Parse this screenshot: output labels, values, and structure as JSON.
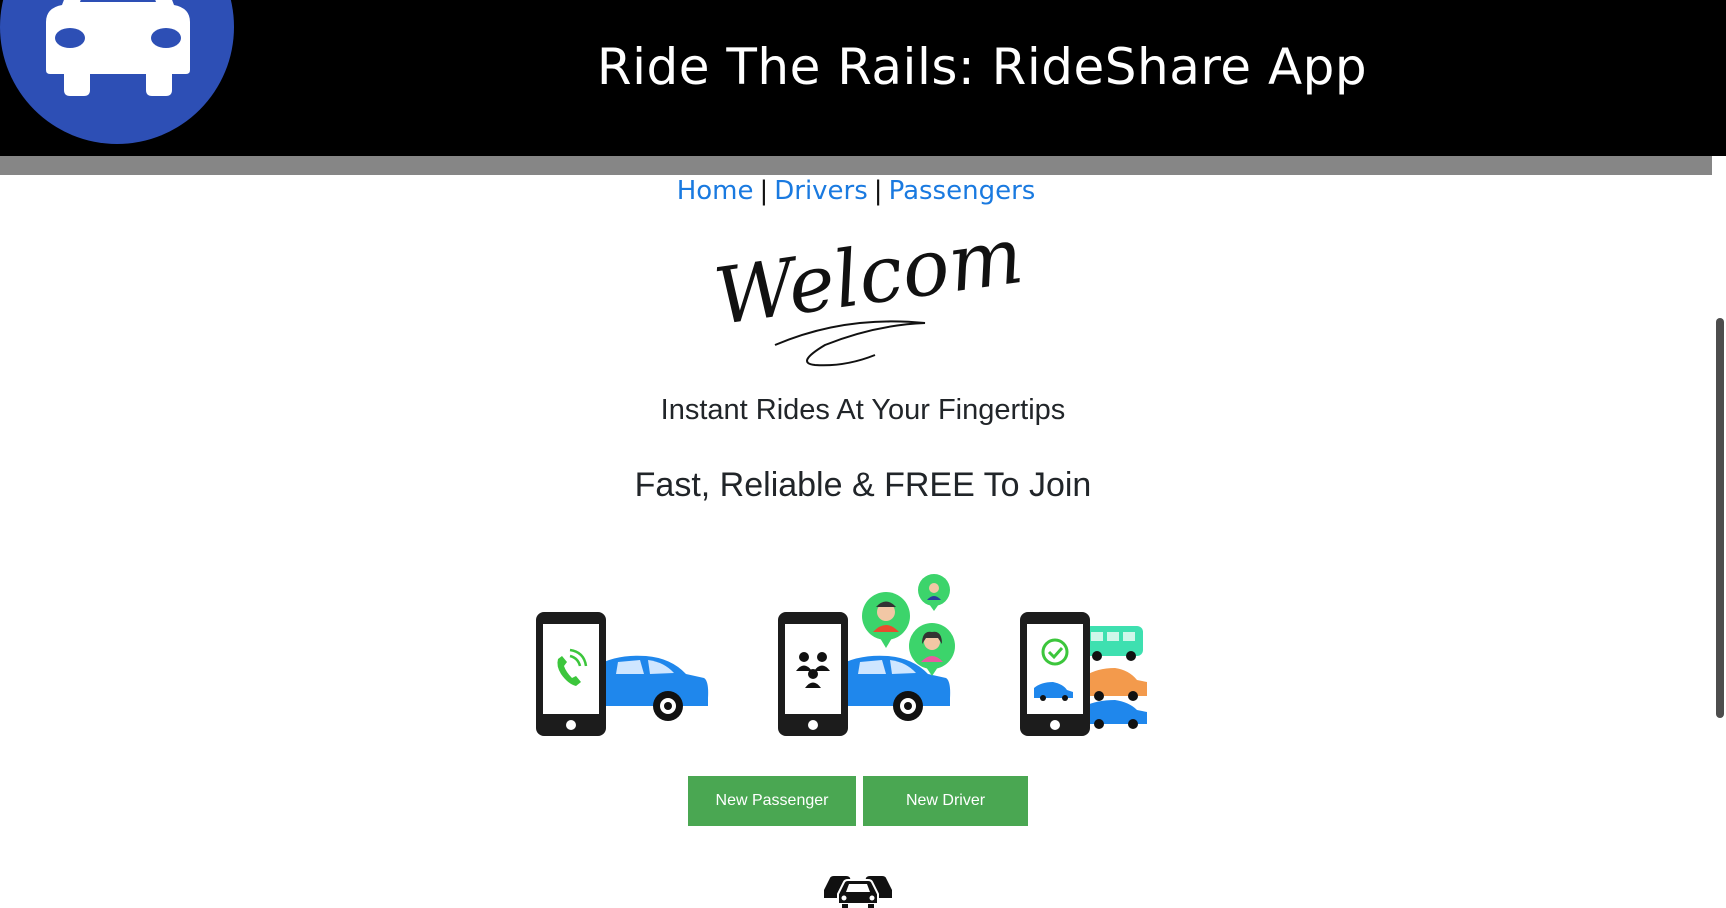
{
  "header": {
    "title": "Ride The Rails: RideShare App",
    "logo_icon": "car-icon",
    "logo_color": "#2d4fb5"
  },
  "nav": {
    "home": "Home",
    "drivers": "Drivers",
    "passengers": "Passengers",
    "separator": "|"
  },
  "hero": {
    "welcome_text": "Welcome!",
    "tagline": "Instant Rides At Your Fingertips",
    "subtitle": "Fast, Reliable & FREE To Join"
  },
  "illustrations": [
    {
      "icon": "phone-call-car-icon"
    },
    {
      "icon": "phone-passengers-car-icon"
    },
    {
      "icon": "phone-check-vehicles-icon"
    }
  ],
  "buttons": {
    "new_passenger": "New Passenger",
    "new_driver": "New Driver"
  },
  "footer": {
    "icon": "cars-icon"
  },
  "colors": {
    "link": "#1a7ae0",
    "button": "#4aa752",
    "header_bg": "#000000",
    "car_blue": "#1f87ec"
  }
}
